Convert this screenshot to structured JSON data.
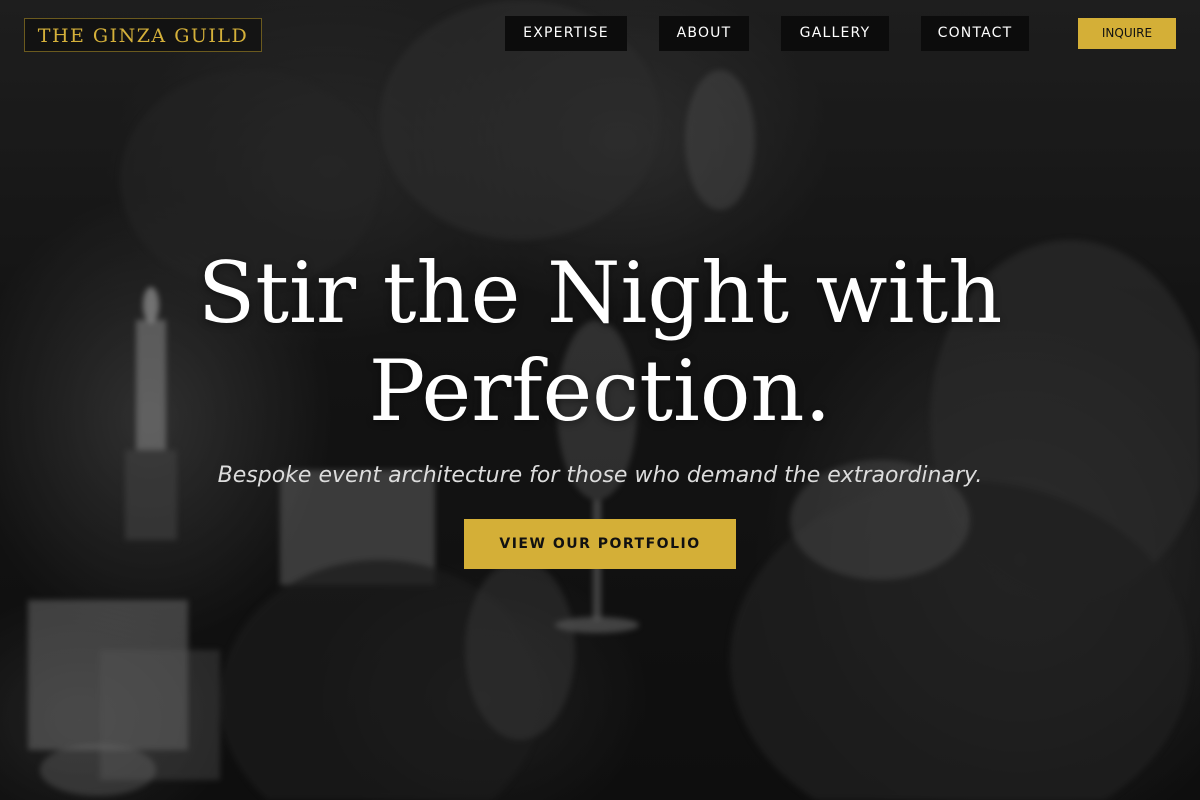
{
  "brand": {
    "logo_text": "THE GINZA GUILD",
    "accent_color": "#d4af37"
  },
  "nav": {
    "items": [
      {
        "label": "EXPERTISE"
      },
      {
        "label": "ABOUT"
      },
      {
        "label": "GALLERY"
      },
      {
        "label": "CONTACT"
      }
    ],
    "inquire_label": "INQUIRE"
  },
  "hero": {
    "headline_line1": "Stir the Night with",
    "headline_line2": "Perfection.",
    "subtitle": "Bespoke event architecture for those who demand the extraordinary.",
    "cta_label": "VIEW OUR PORTFOLIO",
    "background_image": "grayscale blurred photo of a celebration dinner with raised wine glasses and candles"
  }
}
